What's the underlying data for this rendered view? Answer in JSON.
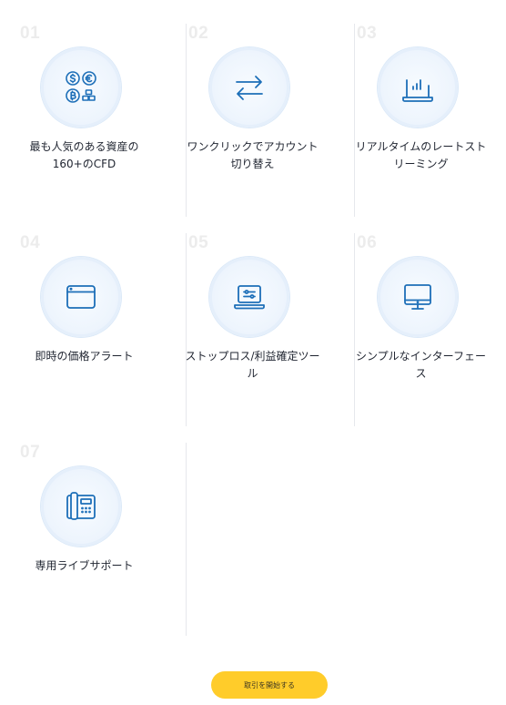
{
  "features": [
    {
      "num": "01",
      "label": "最も人気のある資産の160+のCFD",
      "icon": "assets-currency-icon"
    },
    {
      "num": "02",
      "label": "ワンクリックでアカウント切り替え",
      "icon": "swap-arrows-icon"
    },
    {
      "num": "03",
      "label": "リアルタイムのレートストリーミング",
      "icon": "laptop-chart-icon"
    },
    {
      "num": "04",
      "label": "即時の価格アラート",
      "icon": "browser-window-icon"
    },
    {
      "num": "05",
      "label": "ストップロス/利益確定ツール",
      "icon": "laptop-sliders-icon"
    },
    {
      "num": "06",
      "label": "シンプルなインターフェース",
      "icon": "desktop-monitor-icon"
    },
    {
      "num": "07",
      "label": "専用ライブサポート",
      "icon": "desk-phone-icon"
    }
  ],
  "cta": {
    "label": "取引を開始する"
  },
  "colors": {
    "icon": "#1d6fb8",
    "circle": "#eef5fd",
    "cta": "#ffcc2a",
    "number": "#ececec"
  }
}
